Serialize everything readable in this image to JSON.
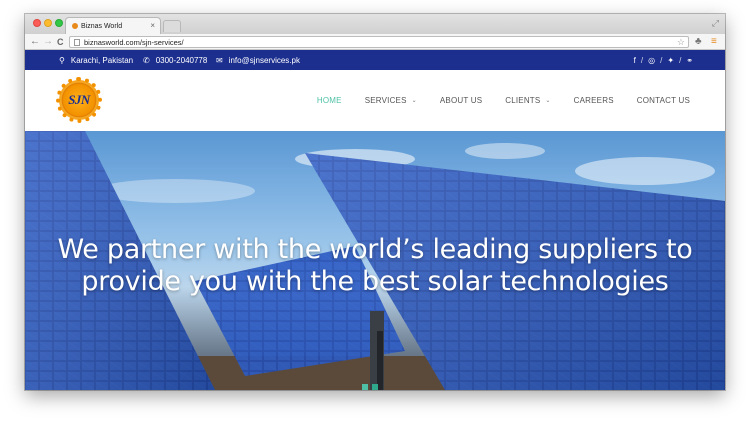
{
  "browser": {
    "tab_title": "Biznas World",
    "url": "biznasworld.com/sjn-services/",
    "tab_close": "×",
    "back": "←",
    "forward": "→",
    "reload": "C",
    "star": "☆",
    "extension": "♣",
    "menu": "≡",
    "resize": "⤢"
  },
  "topbar": {
    "location": "Karachi, Pakistan",
    "phone": "0300-2040778",
    "email": "info@sjnservices.pk",
    "location_icon": "map-marker-icon",
    "phone_icon": "phone-icon",
    "email_icon": "envelope-icon",
    "social": [
      {
        "icon": "facebook-icon",
        "glyph": "f"
      },
      {
        "icon": "instagram-icon",
        "glyph": "◎"
      },
      {
        "icon": "twitter-icon",
        "glyph": "🐦"
      },
      {
        "icon": "link-icon",
        "glyph": "⚭"
      }
    ],
    "color": "#1c2f8f"
  },
  "header": {
    "logo_text": "SJN",
    "nav": [
      {
        "label": "HOME",
        "active": true
      },
      {
        "label": "SERVICES",
        "dropdown": true
      },
      {
        "label": "ABOUT US"
      },
      {
        "label": "CLIENTS",
        "dropdown": true
      },
      {
        "label": "CAREERS"
      },
      {
        "label": "CONTACT US"
      }
    ],
    "accent": "#4fc1a6",
    "chevron": "⌄"
  },
  "hero": {
    "headline_line1": "We partner with the world’s leading suppliers to",
    "headline_line2": "provide you with the best solar technologies",
    "slides": 3,
    "active_slide": 2
  }
}
